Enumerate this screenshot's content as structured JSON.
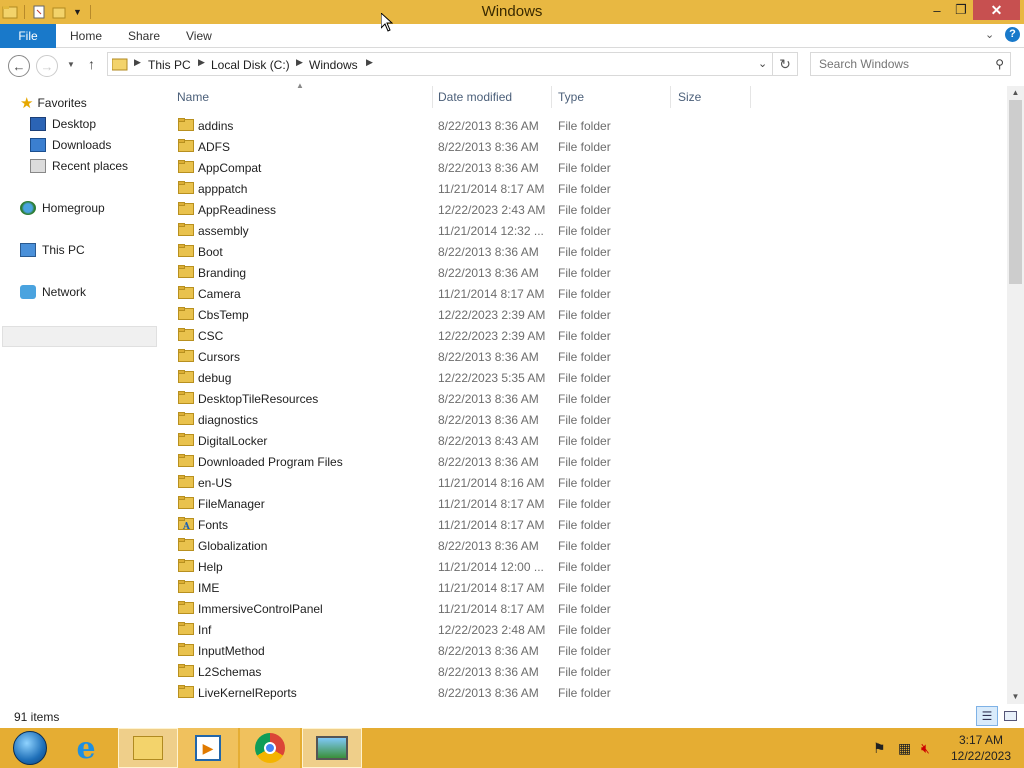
{
  "window": {
    "title": "Windows",
    "controls": {
      "minimize": "–",
      "maximize": "❐",
      "close": "✕"
    }
  },
  "ribbon": {
    "file_tab": "File",
    "tabs": [
      "Home",
      "Share",
      "View"
    ],
    "help": "?"
  },
  "address_bar": {
    "crumbs": [
      "This PC",
      "Local Disk (C:)",
      "Windows"
    ]
  },
  "search": {
    "placeholder": "Search Windows"
  },
  "nav_pane": {
    "favorites": "Favorites",
    "favorite_items": [
      "Desktop",
      "Downloads",
      "Recent places"
    ],
    "homegroup": "Homegroup",
    "this_pc": "This PC",
    "network": "Network"
  },
  "columns": {
    "name": "Name",
    "date": "Date modified",
    "type": "Type",
    "size": "Size"
  },
  "files": [
    {
      "name": "addins",
      "date": "8/22/2013 8:36 AM",
      "type": "File folder"
    },
    {
      "name": "ADFS",
      "date": "8/22/2013 8:36 AM",
      "type": "File folder"
    },
    {
      "name": "AppCompat",
      "date": "8/22/2013 8:36 AM",
      "type": "File folder"
    },
    {
      "name": "apppatch",
      "date": "11/21/2014 8:17 AM",
      "type": "File folder"
    },
    {
      "name": "AppReadiness",
      "date": "12/22/2023 2:43 AM",
      "type": "File folder"
    },
    {
      "name": "assembly",
      "date": "11/21/2014 12:32 ...",
      "type": "File folder"
    },
    {
      "name": "Boot",
      "date": "8/22/2013 8:36 AM",
      "type": "File folder"
    },
    {
      "name": "Branding",
      "date": "8/22/2013 8:36 AM",
      "type": "File folder"
    },
    {
      "name": "Camera",
      "date": "11/21/2014 8:17 AM",
      "type": "File folder"
    },
    {
      "name": "CbsTemp",
      "date": "12/22/2023 2:39 AM",
      "type": "File folder"
    },
    {
      "name": "CSC",
      "date": "12/22/2023 2:39 AM",
      "type": "File folder"
    },
    {
      "name": "Cursors",
      "date": "8/22/2013 8:36 AM",
      "type": "File folder"
    },
    {
      "name": "debug",
      "date": "12/22/2023 5:35 AM",
      "type": "File folder"
    },
    {
      "name": "DesktopTileResources",
      "date": "8/22/2013 8:36 AM",
      "type": "File folder"
    },
    {
      "name": "diagnostics",
      "date": "8/22/2013 8:36 AM",
      "type": "File folder"
    },
    {
      "name": "DigitalLocker",
      "date": "8/22/2013 8:43 AM",
      "type": "File folder"
    },
    {
      "name": "Downloaded Program Files",
      "date": "8/22/2013 8:36 AM",
      "type": "File folder"
    },
    {
      "name": "en-US",
      "date": "11/21/2014 8:16 AM",
      "type": "File folder"
    },
    {
      "name": "FileManager",
      "date": "11/21/2014 8:17 AM",
      "type": "File folder"
    },
    {
      "name": "Fonts",
      "date": "11/21/2014 8:17 AM",
      "type": "File folder",
      "icon": "fonts-folder-icon"
    },
    {
      "name": "Globalization",
      "date": "8/22/2013 8:36 AM",
      "type": "File folder"
    },
    {
      "name": "Help",
      "date": "11/21/2014 12:00 ...",
      "type": "File folder"
    },
    {
      "name": "IME",
      "date": "11/21/2014 8:17 AM",
      "type": "File folder"
    },
    {
      "name": "ImmersiveControlPanel",
      "date": "11/21/2014 8:17 AM",
      "type": "File folder"
    },
    {
      "name": "Inf",
      "date": "12/22/2023 2:48 AM",
      "type": "File folder"
    },
    {
      "name": "InputMethod",
      "date": "8/22/2013 8:36 AM",
      "type": "File folder"
    },
    {
      "name": "L2Schemas",
      "date": "8/22/2013 8:36 AM",
      "type": "File folder"
    },
    {
      "name": "LiveKernelReports",
      "date": "8/22/2013 8:36 AM",
      "type": "File folder"
    }
  ],
  "status": {
    "item_count": "91 items"
  },
  "taskbar": {
    "items": [
      "start-orb-icon",
      "internet-explorer-icon",
      "file-explorer-icon",
      "media-player-icon",
      "chrome-icon",
      "photo-viewer-icon"
    ],
    "time": "3:17 AM",
    "date": "12/22/2023"
  },
  "colors": {
    "titlebar": "#e8b842",
    "file_tab": "#1979ca",
    "taskbar": "#e5ad33",
    "folder": "#e9c24d",
    "close_button": "#c75050"
  }
}
